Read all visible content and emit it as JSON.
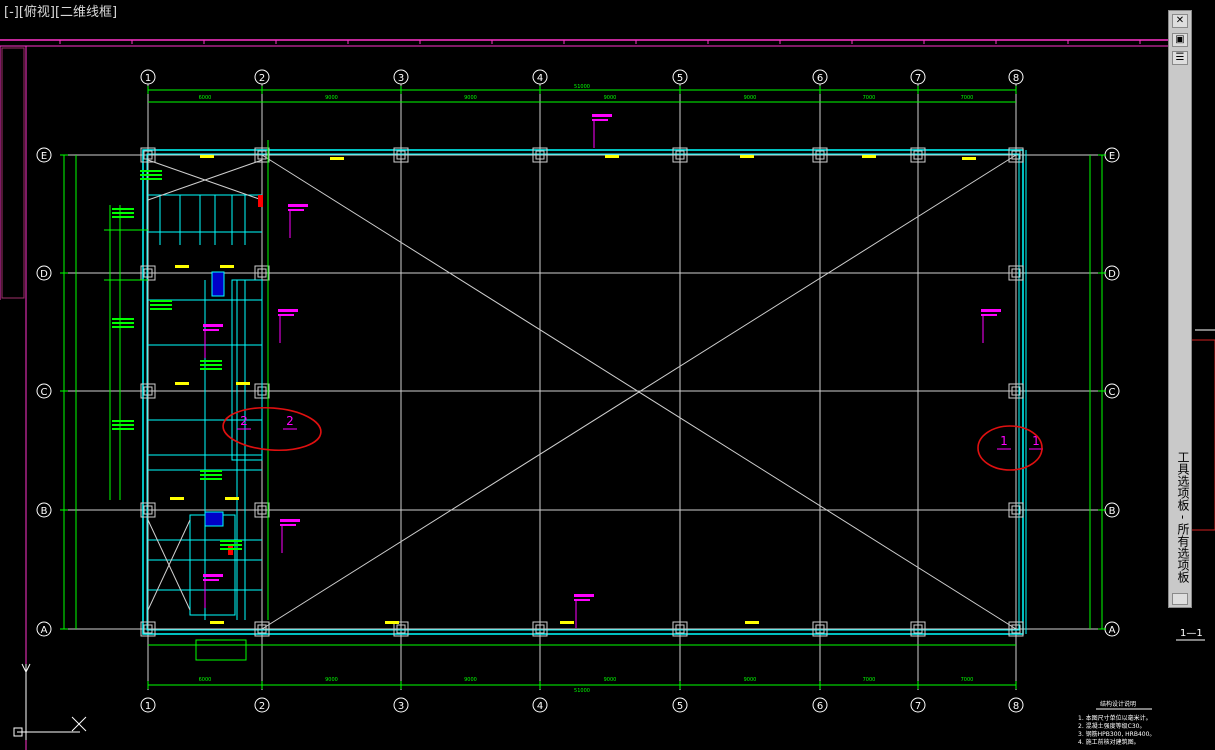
{
  "viewport": {
    "label": "[-][俯视][二维线框]"
  },
  "palette": {
    "title": "工具选项板 - 所有选项板",
    "close_glyph": "✕"
  },
  "drawing": {
    "column_axes": [
      "1",
      "2",
      "3",
      "4",
      "5",
      "6",
      "7",
      "8"
    ],
    "row_axes": [
      "E",
      "D",
      "C",
      "B",
      "A"
    ],
    "top_spans": [
      "6000",
      "9000",
      "9000",
      "9000",
      "9000",
      "7000",
      "7000"
    ],
    "top_total": "51000",
    "bottom_spans": [
      "6000",
      "9000",
      "9000",
      "9000",
      "9000",
      "7000",
      "7000"
    ],
    "bottom_total": "51000",
    "section_marks": [
      {
        "left": "1",
        "right": "1",
        "color": "#ff00ff"
      },
      {
        "left": "2",
        "right": "2",
        "color": "#ff00ff"
      }
    ],
    "markup_color": "#e01010",
    "notes_title": "结构设计说明",
    "notes_lines": [
      "1. 本图尺寸单位以毫米计。",
      "2. 混凝土强度等级C30。",
      "3. 钢筋HPB300, HRB400。",
      "4. 施工前核对建筑图。"
    ],
    "section_label": "1—1",
    "colors": {
      "grid_line": "#cfcfcf",
      "dimension": "#00ff00",
      "beam": "#00ffff",
      "text_tag": "#ffff00",
      "annotation": "#ff00ff",
      "border": "#ff33cc"
    }
  }
}
